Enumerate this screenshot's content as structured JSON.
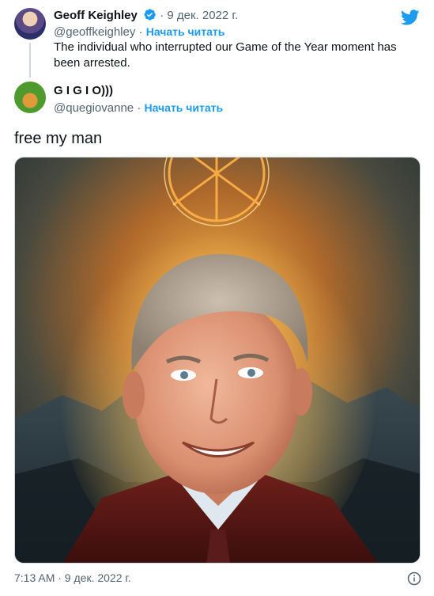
{
  "quoted_tweet": {
    "author_name": "Geoff Keighley",
    "separator": "·",
    "date": "9 дек. 2022 г.",
    "handle": "@geoffkeighley",
    "follow_label": "Начать читать",
    "text": "The individual who interrupted our Game of the Year moment has been arrested."
  },
  "reply_tweet": {
    "author_name": "G I G I O)))",
    "handle": "@quegiovanne",
    "separator": "·",
    "follow_label": "Начать читать",
    "text": "free my man",
    "timestamp": "7:13 AM · 9 дек. 2022 г."
  },
  "icons": {
    "brand": "twitter-bird-icon",
    "verified": "verified-badge-icon",
    "info": "info-icon"
  },
  "colors": {
    "accent": "#1d9bf0",
    "text": "#0f1419",
    "muted": "#536471"
  }
}
